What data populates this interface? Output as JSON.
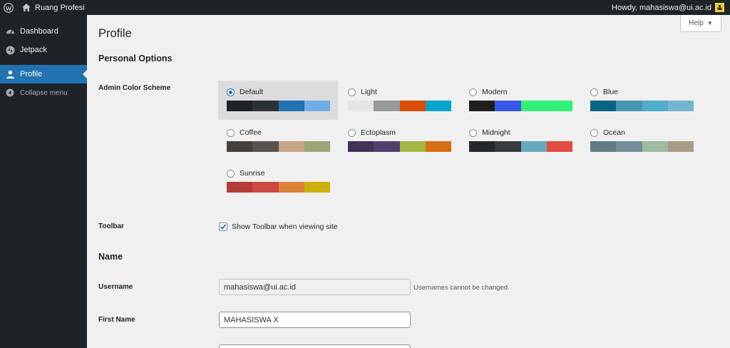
{
  "adminbar": {
    "site_name": "Ruang Profesi",
    "greeting": "Howdy, mahasiswa@ui.ac.id"
  },
  "sidebar": {
    "items": [
      {
        "label": "Dashboard",
        "icon": "dashboard-icon"
      },
      {
        "label": "Jetpack",
        "icon": "jetpack-icon"
      },
      {
        "label": "Profile",
        "icon": "user-icon",
        "active": true
      },
      {
        "label": "Collapse menu",
        "icon": "collapse-icon"
      }
    ]
  },
  "header": {
    "help_label": "Help",
    "page_title": "Profile"
  },
  "sections": {
    "personal_options": "Personal Options",
    "name": "Name"
  },
  "color_scheme": {
    "label": "Admin Color Scheme",
    "selected": "Default",
    "schemes": [
      {
        "name": "Default",
        "colors": [
          "#1d2327",
          "#2c3338",
          "#2271b1",
          "#72aee6"
        ]
      },
      {
        "name": "Light",
        "colors": [
          "#e5e5e5",
          "#999999",
          "#d64e07",
          "#04a4cc"
        ]
      },
      {
        "name": "Modern",
        "colors": [
          "#1e1e1e",
          "#3858e9",
          "#33f078",
          "#33f078"
        ]
      },
      {
        "name": "Blue",
        "colors": [
          "#096484",
          "#4796b3",
          "#52accc",
          "#74b6ce"
        ]
      },
      {
        "name": "Coffee",
        "colors": [
          "#46403c",
          "#59524c",
          "#c7a589",
          "#9ea476"
        ]
      },
      {
        "name": "Ectoplasm",
        "colors": [
          "#413256",
          "#523f6d",
          "#a3b745",
          "#d46f15"
        ]
      },
      {
        "name": "Midnight",
        "colors": [
          "#25282b",
          "#363b3f",
          "#69a8bb",
          "#e14d43"
        ]
      },
      {
        "name": "Ocean",
        "colors": [
          "#627c83",
          "#738e96",
          "#9ebaa0",
          "#aa9d88"
        ]
      },
      {
        "name": "Sunrise",
        "colors": [
          "#b43c38",
          "#cf4944",
          "#dd823b",
          "#ccaf0b"
        ]
      }
    ]
  },
  "toolbar": {
    "label": "Toolbar",
    "option": "Show Toolbar when viewing site",
    "checked": true
  },
  "fields": {
    "username_label": "Username",
    "username_value": "mahasiswa@ui.ac.id",
    "username_desc": "Usernames cannot be changed.",
    "first_name_label": "First Name",
    "first_name_value": "MAHASISWA X"
  }
}
